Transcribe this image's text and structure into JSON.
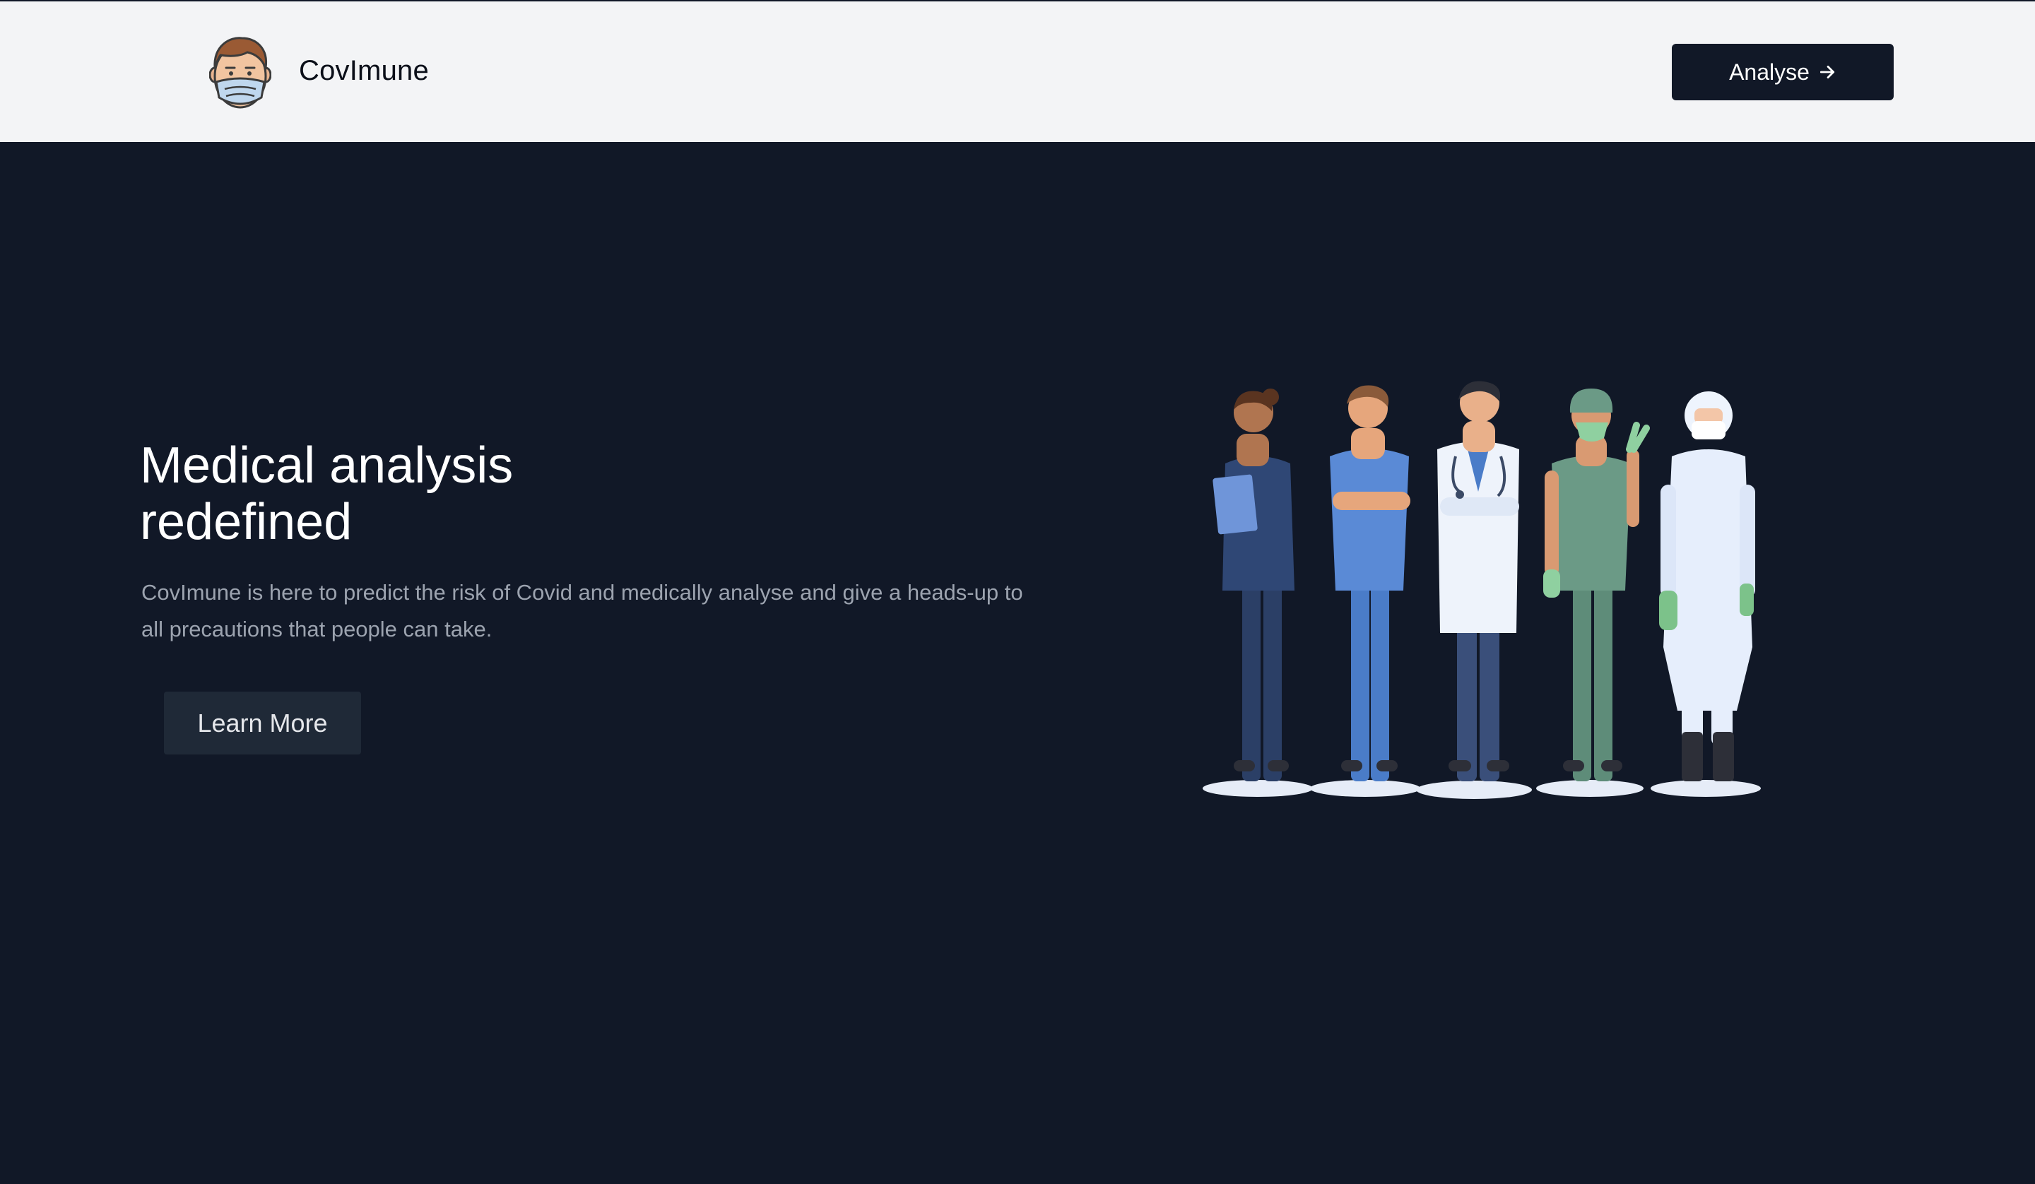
{
  "header": {
    "brand": "CovImune",
    "analyse_label": "Analyse"
  },
  "hero": {
    "title_line1": "Medical analysis",
    "title_line2": "redefined",
    "description": "CovImune is here to predict the risk of Covid and medically analyse and give a heads-up to all precautions that people can take.",
    "learn_more_label": "Learn More"
  },
  "icons": {
    "logo": "masked-face-avatar-icon",
    "analyse_arrow": "arrow-right-icon"
  },
  "colors": {
    "header_bg": "#f3f4f6",
    "page_bg": "#111827",
    "primary_button": "#111827",
    "secondary_button": "#1f2937",
    "muted_text": "#9ca3af"
  }
}
